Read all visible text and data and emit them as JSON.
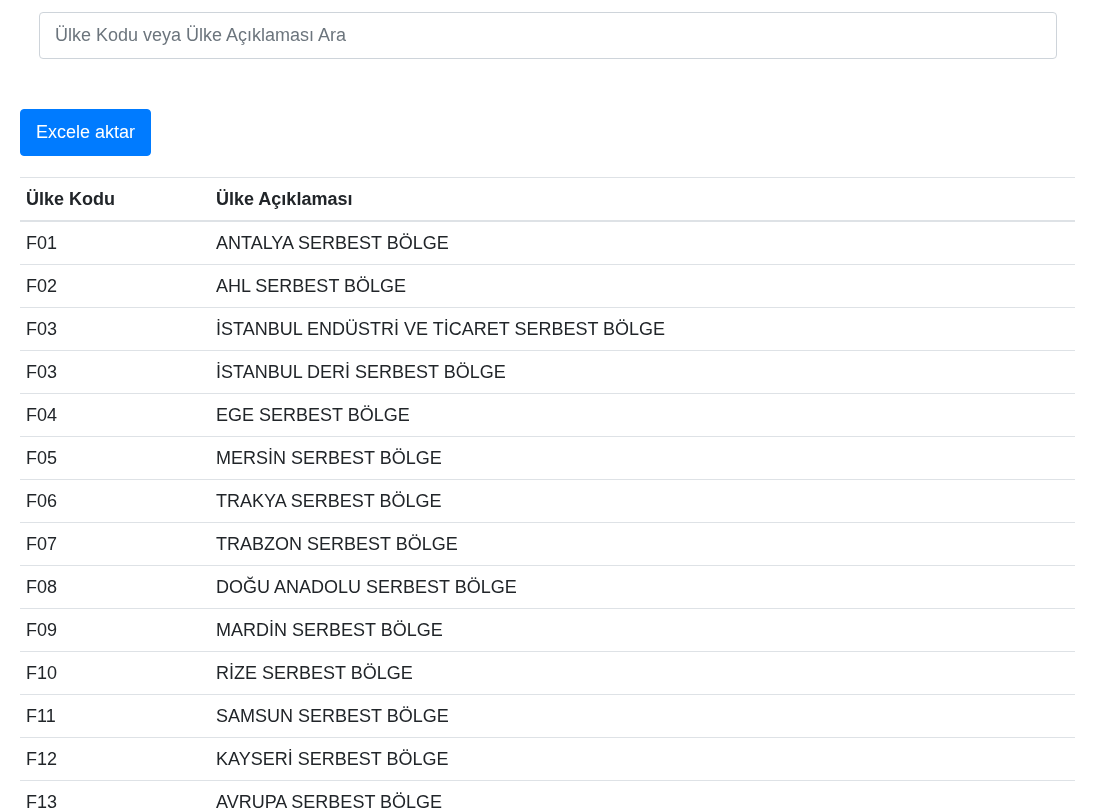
{
  "search": {
    "placeholder": "Ülke Kodu veya Ülke Açıklaması Ara"
  },
  "export_button": {
    "label": "Excele aktar"
  },
  "table": {
    "columns": [
      "Ülke Kodu",
      "Ülke Açıklaması"
    ],
    "rows": [
      [
        "F01",
        "ANTALYA SERBEST BÖLGE"
      ],
      [
        "F02",
        "AHL SERBEST BÖLGE"
      ],
      [
        "F03",
        "İSTANBUL ENDÜSTRİ VE TİCARET SERBEST BÖLGE"
      ],
      [
        "F03",
        "İSTANBUL DERİ SERBEST BÖLGE"
      ],
      [
        "F04",
        "EGE SERBEST BÖLGE"
      ],
      [
        "F05",
        "MERSİN SERBEST BÖLGE"
      ],
      [
        "F06",
        "TRAKYA SERBEST BÖLGE"
      ],
      [
        "F07",
        "TRABZON SERBEST BÖLGE"
      ],
      [
        "F08",
        "DOĞU ANADOLU SERBEST BÖLGE"
      ],
      [
        "F09",
        "MARDİN SERBEST BÖLGE"
      ],
      [
        "F10",
        "RİZE SERBEST BÖLGE"
      ],
      [
        "F11",
        "SAMSUN SERBEST BÖLGE"
      ],
      [
        "F12",
        "KAYSERİ SERBEST BÖLGE"
      ],
      [
        "F13",
        "AVRUPA SERBEST BÖLGE"
      ]
    ]
  }
}
